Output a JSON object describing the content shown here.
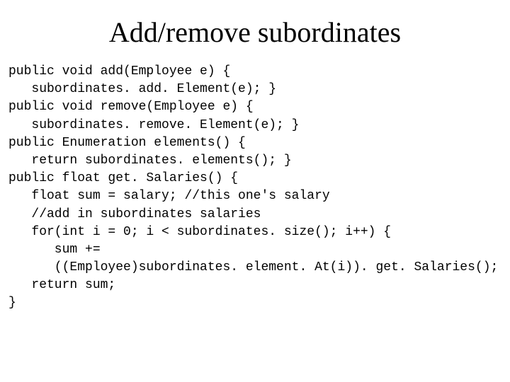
{
  "title": "Add/remove subordinates",
  "code": "public void add(Employee e) {\n   subordinates. add. Element(e); }\npublic void remove(Employee e) {\n   subordinates. remove. Element(e); }\npublic Enumeration elements() {\n   return subordinates. elements(); }\npublic float get. Salaries() {\n   float sum = salary; //this one's salary\n   //add in subordinates salaries\n   for(int i = 0; i < subordinates. size(); i++) {\n      sum +=\n      ((Employee)subordinates. element. At(i)). get. Salaries();\n   return sum;\n}"
}
